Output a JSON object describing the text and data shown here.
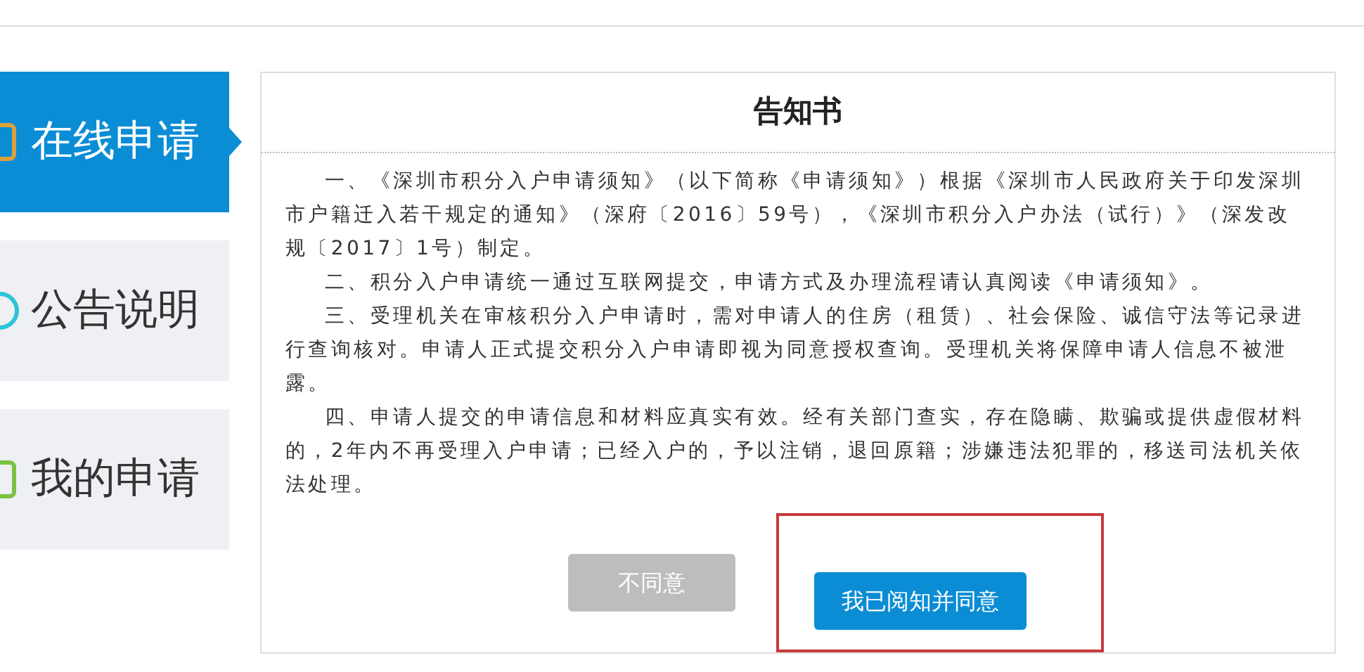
{
  "sidebar": {
    "items": [
      {
        "label": "在线申请",
        "selected": true,
        "color": "#d9a23a"
      },
      {
        "label": "公告说明",
        "selected": false,
        "color": "#2ec4d6"
      },
      {
        "label": "我的申请",
        "selected": false,
        "color": "#7cc242"
      }
    ]
  },
  "notice": {
    "title": "告知书",
    "paragraphs": [
      "一、《深圳市积分入户申请须知》（以下简称《申请须知》）根据《深圳市人民政府关于印发深圳市户籍迁入若干规定的通知》（深府〔2016〕59号），《深圳市积分入户办法（试行）》（深发改规〔2017〕1号）制定。",
      "二、积分入户申请统一通过互联网提交，申请方式及办理流程请认真阅读《申请须知》。",
      "三、受理机关在审核积分入户申请时，需对申请人的住房（租赁）、社会保险、诚信守法等记录进行查询核对。申请人正式提交积分入户申请即视为同意授权查询。受理机关将保障申请人信息不被泄露。",
      "四、申请人提交的申请信息和材料应真实有效。经有关部门查实，存在隐瞒、欺骗或提供虚假材料的，2年内不再受理入户申请；已经入户的，予以注销，退回原籍；涉嫌违法犯罪的，移送司法机关依法处理。"
    ],
    "buttons": [
      {
        "label": "不同意",
        "kind": "secondary",
        "highlighted": false
      },
      {
        "label": "我已阅知并同意",
        "kind": "primary",
        "highlighted": true
      }
    ]
  }
}
